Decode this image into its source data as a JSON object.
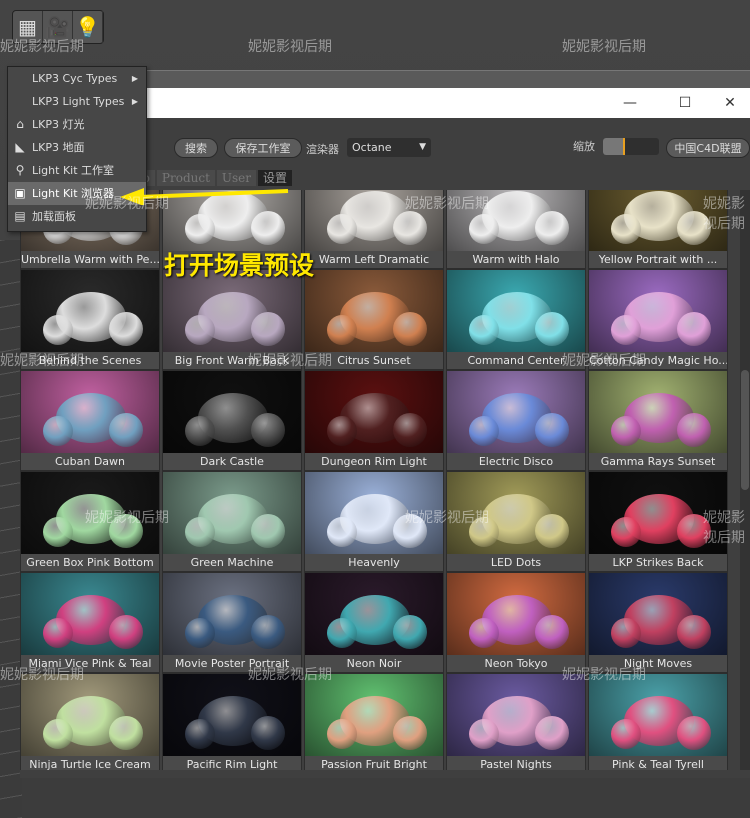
{
  "toolbar": {
    "search": "搜索",
    "save_studio": "保存工作室",
    "renderer_label": "渲染器",
    "renderer_value": "Octane",
    "zoom_label": "缩放",
    "zoom_level": 0.3,
    "alliance": "中国C4D联盟"
  },
  "tabs": [
    "op",
    "Product",
    "User",
    "设置"
  ],
  "active_tab": 3,
  "window_controls": {
    "minimize": "—",
    "maximize": "☐",
    "close": "✕"
  },
  "menu": [
    {
      "icon": "",
      "label": "LKP3 Cyc Types",
      "submenu": true
    },
    {
      "icon": "",
      "label": "LKP3 Light Types",
      "submenu": true
    },
    {
      "icon": "lamp-icon",
      "label": "LKP3 灯光"
    },
    {
      "icon": "floor-icon",
      "label": "LKP3 地面"
    },
    {
      "icon": "studio-icon",
      "label": "Light Kit 工作室"
    },
    {
      "icon": "browser-icon",
      "label": "Light Kit 浏览器",
      "highlighted": true
    },
    {
      "icon": "panel-icon",
      "label": "加载面板"
    }
  ],
  "annotation": "打开场景预设",
  "watermark": "妮妮影视后期",
  "presets": [
    {
      "name": "Umbrella Warm with Pe...",
      "bg": "#8a7a6a",
      "ball": "#ddd"
    },
    {
      "name": "",
      "bg": "#b0aca8",
      "ball": "#eee"
    },
    {
      "name": "Warm Left Dramatic",
      "bg": "#a8a29c",
      "ball": "#e8e6e2"
    },
    {
      "name": "Warm with Halo",
      "bg": "#b8b6b8",
      "ball": "#eeeeee"
    },
    {
      "name": "Yellow Portrait with ...",
      "bg": "#6b5d30",
      "ball": "#e8e2c8"
    },
    {
      "name": "Behind the Scenes",
      "bg": "#2a2a2a",
      "ball": "#ddd"
    },
    {
      "name": "Big Front Warm Back",
      "bg": "#7a6a78",
      "ball": "#b8a8c0"
    },
    {
      "name": "Citrus Sunset",
      "bg": "#8a5a3a",
      "ball": "#d08050"
    },
    {
      "name": "Command Center",
      "bg": "#3aa8b0",
      "ball": "#80e0e8"
    },
    {
      "name": "Cotton Candy Magic Ho...",
      "bg": "#9a6ac0",
      "ball": "#e0a0d8"
    },
    {
      "name": "Cuban Dawn",
      "bg": "#c060a0",
      "ball": "#70a0c0"
    },
    {
      "name": "Dark Castle",
      "bg": "#101010",
      "ball": "#505050"
    },
    {
      "name": "Dungeon Rim Light",
      "bg": "#5a1010",
      "ball": "#502020"
    },
    {
      "name": "Electric Disco",
      "bg": "#9a7ab8",
      "ball": "#6a8ad8"
    },
    {
      "name": "Gamma Rays Sunset",
      "bg": "#a0b070",
      "ball": "#c060b0"
    },
    {
      "name": "Green Box Pink Bottom",
      "bg": "#1a1a1a",
      "ball": "#a0d8a0"
    },
    {
      "name": "Green Machine",
      "bg": "#7a9a8a",
      "ball": "#a0c8b0"
    },
    {
      "name": "Heavenly",
      "bg": "#9ab0d8",
      "ball": "#e0e8f8"
    },
    {
      "name": "LED Dots",
      "bg": "#a09a58",
      "ball": "#d0c888"
    },
    {
      "name": "LKP Strikes Back",
      "bg": "#101010",
      "ball": "#e04060"
    },
    {
      "name": "Miami Vice Pink & Teal",
      "bg": "#3a8890",
      "ball": "#d04080"
    },
    {
      "name": "Movie Poster Portrait",
      "bg": "#6a7080",
      "ball": "#3a5a80"
    },
    {
      "name": "Neon Noir",
      "bg": "#2a1a2a",
      "ball": "#40a8b0"
    },
    {
      "name": "Neon Tokyo",
      "bg": "#d06a40",
      "ball": "#c060c0"
    },
    {
      "name": "Night Moves",
      "bg": "#2a3a6a",
      "ball": "#c04060"
    },
    {
      "name": "Ninja Turtle Ice Cream",
      "bg": "#a0987a",
      "ball": "#c0e0a0"
    },
    {
      "name": "Pacific Rim Light",
      "bg": "#101018",
      "ball": "#303848"
    },
    {
      "name": "Passion Fruit Bright",
      "bg": "#60c070",
      "ball": "#e0a080"
    },
    {
      "name": "Pastel Nights",
      "bg": "#6a5aa0",
      "ball": "#e0a0c8"
    },
    {
      "name": "Pink & Teal Tyrell",
      "bg": "#4aa0a8",
      "ball": "#e05080"
    }
  ]
}
